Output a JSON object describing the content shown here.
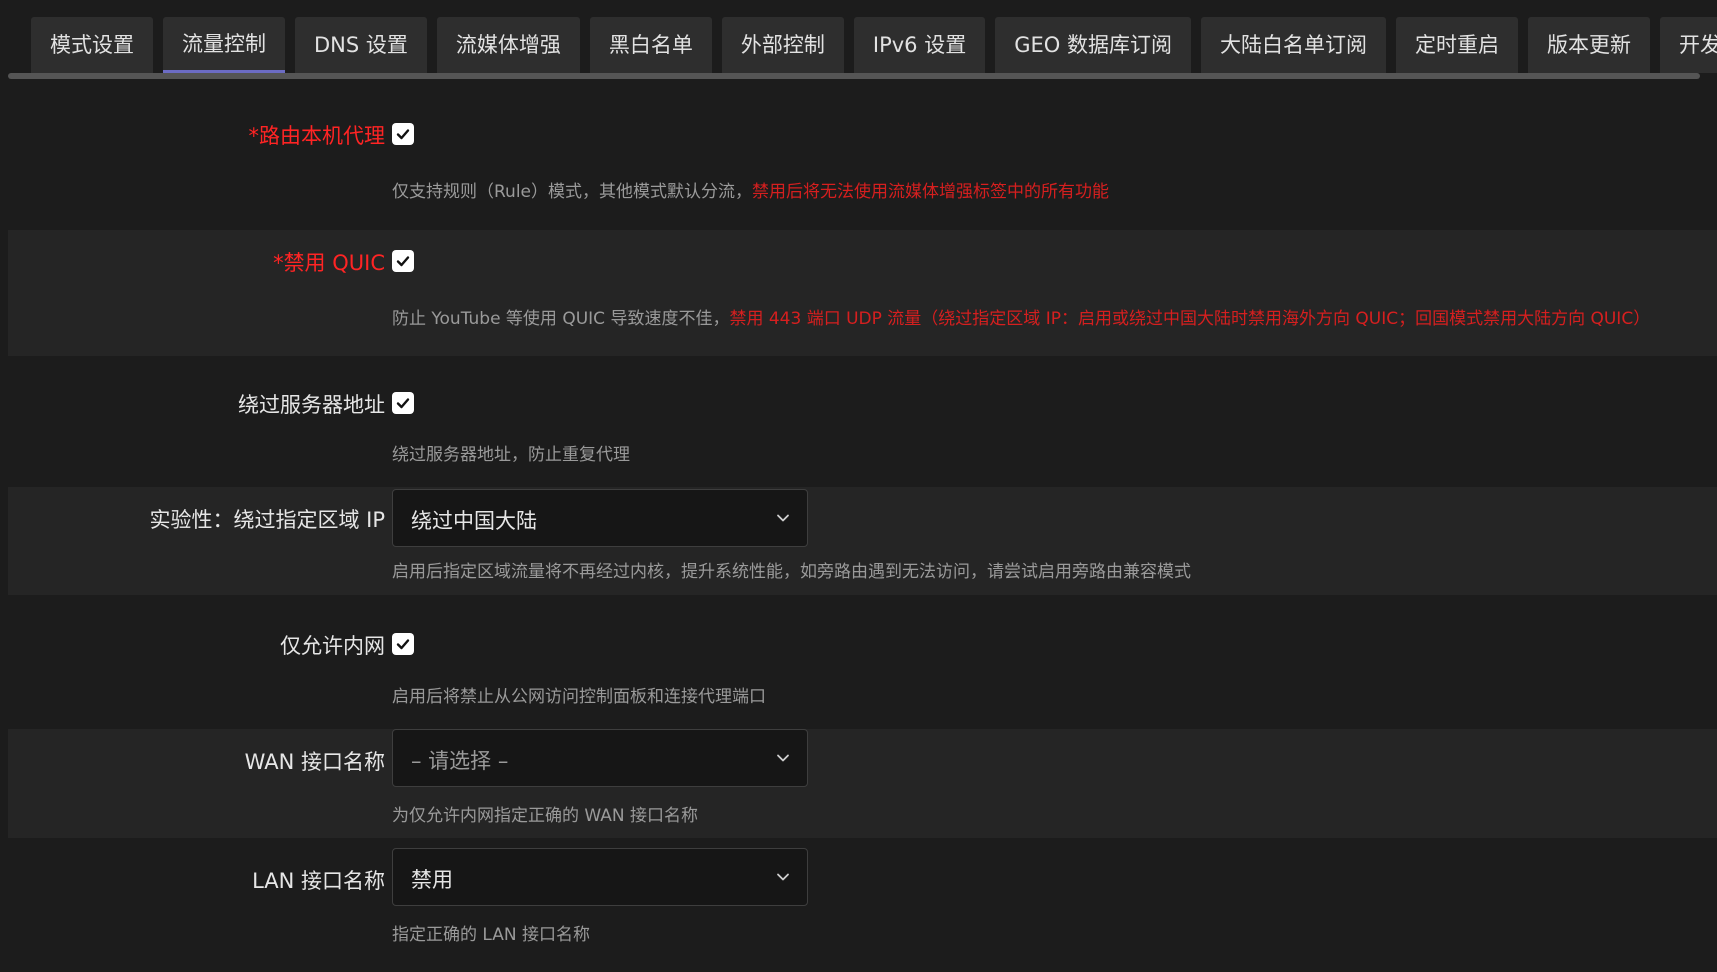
{
  "tabs": [
    "模式设置",
    "流量控制",
    "DNS 设置",
    "流媒体增强",
    "黑白名单",
    "外部控制",
    "IPv6 设置",
    "GEO 数据库订阅",
    "大陆白名单订阅",
    "定时重启",
    "版本更新",
    "开发者"
  ],
  "active_tab": "流量控制",
  "rows": {
    "route_local": {
      "label": "*路由本机代理",
      "checked": true,
      "desc": "仅支持规则（Rule）模式，其他模式默认分流，",
      "warn": "禁用后将无法使用流媒体增强标签中的所有功能"
    },
    "disable_quic": {
      "label": "*禁用 QUIC",
      "checked": true,
      "desc": "防止 YouTube 等使用 QUIC 导致速度不佳，",
      "warn": "禁用 443 端口 UDP 流量（绕过指定区域 IP：启用或绕过中国大陆时禁用海外方向 QUIC；回国模式禁用大陆方向 QUIC）"
    },
    "bypass_server": {
      "label": "绕过服务器地址",
      "checked": true,
      "desc": "绕过服务器地址，防止重复代理"
    },
    "bypass_region": {
      "label": "实验性：绕过指定区域 IP",
      "value": "绕过中国大陆",
      "desc": "启用后指定区域流量将不再经过内核，提升系统性能，如旁路由遇到无法访问，请尝试启用旁路由兼容模式"
    },
    "lan_only": {
      "label": "仅允许内网",
      "checked": true,
      "desc": "启用后将禁止从公网访问控制面板和连接代理端口"
    },
    "wan_iface": {
      "label": "WAN 接口名称",
      "placeholder": "– 请选择 –",
      "desc": "为仅允许内网指定正确的 WAN 接口名称"
    },
    "lan_iface": {
      "label": "LAN 接口名称",
      "value": "禁用",
      "desc": "指定正确的 LAN 接口名称"
    }
  }
}
